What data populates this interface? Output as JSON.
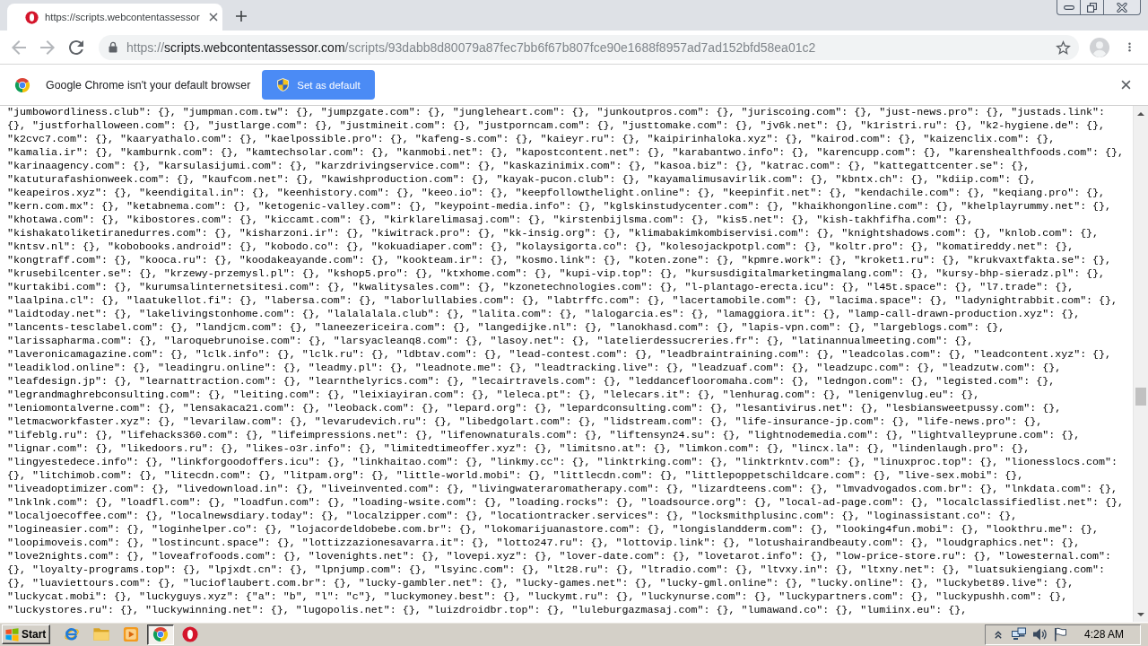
{
  "tabs": [
    {
      "title": "https://scripts.webcontentassessor",
      "selected": true
    }
  ],
  "navigation": [
    {
      "kind": "back",
      "disabled": true
    },
    {
      "kind": "forward",
      "disabled": true
    },
    {
      "kind": "reload",
      "disabled": false
    }
  ],
  "address_bar": {
    "scheme": "https://",
    "host": "scripts.webcontentassessor.com",
    "path": "/scripts/93dabb8d80079a87fec7bb6f67b807fce90e1688f8957ad7ad152bfd58ea01c2",
    "bookmarked": false
  },
  "infobar": {
    "message": "Google Chrome isn't your default browser",
    "button": "Set as default"
  },
  "page": {
    "lines": [
      "\"jumbowordliness.club\": {}, \"jumpman.com.tw\": {}, \"jumpzgate.com\": {}, \"jungleheart.com\": {}, \"junkoutpros.com\": {}, \"juriscoing.com\": {}, \"just-news.pro\": {}, \"justads.link\":",
      "{}, \"justforhalloween.com\": {}, \"justlarge.com\": {}, \"justmineit.com\": {}, \"justporncam.com\": {}, \"justtomake.com\": {}, \"jv6k.net\": {}, \"k1ristri.ru\": {}, \"k2-hygiene.de\": {},",
      "\"k2cvc7.com\": {}, \"kaaryathalo.com\": {}, \"kaelpossible.pro\": {}, \"kafeng-s.com\": {}, \"kaieyr.ru\": {}, \"kaipirinhaloka.xyz\": {}, \"kairod.com\": {}, \"kaizenclix.com\": {},",
      "\"kamalia.ir\": {}, \"kamburnk.com\": {}, \"kamtechsolar.com\": {}, \"kanmobi.net\": {}, \"kapostcontent.net\": {}, \"karabantwo.info\": {}, \"karencupp.com\": {}, \"karenshealthfoods.com\": {},",
      "\"karinaagency.com\": {}, \"karsulasijumi.com\": {}, \"karzdrivingservice.com\": {}, \"kaskazinimix.com\": {}, \"kasoa.biz\": {}, \"katrac.com\": {}, \"kattegattcenter.se\": {},",
      "\"katuturafashionweek.com\": {}, \"kaufcom.net\": {}, \"kawishproduction.com\": {}, \"kayak-pucon.club\": {}, \"kayamalimusavirlik.com\": {}, \"kbntx.ch\": {}, \"kdiip.com\": {},",
      "\"keapeiros.xyz\": {}, \"keendigital.in\": {}, \"keenhistory.com\": {}, \"keeo.io\": {}, \"keepfollowthelight.online\": {}, \"keepinfit.net\": {}, \"kendachile.com\": {}, \"keqiang.pro\": {},",
      "\"kern.com.mx\": {}, \"ketabnema.com\": {}, \"ketogenic-valley.com\": {}, \"keypoint-media.info\": {}, \"kglskinstudycenter.com\": {}, \"khaikhongonline.com\": {}, \"khelplayrummy.net\": {},",
      "\"khotawa.com\": {}, \"kibostores.com\": {}, \"kiccamt.com\": {}, \"kirklarelimasaj.com\": {}, \"kirstenbijlsma.com\": {}, \"kis5.net\": {}, \"kish-takhfifha.com\": {},",
      "\"kishakatoliketiranedurres.com\": {}, \"kisharzoni.ir\": {}, \"kiwitrack.pro\": {}, \"kk-insig.org\": {}, \"klimabakimkombiservisi.com\": {}, \"knightshadows.com\": {}, \"knlob.com\": {},",
      "\"kntsv.nl\": {}, \"kobobooks.android\": {}, \"kobodo.co\": {}, \"kokuadiaper.com\": {}, \"kolaysigorta.co\": {}, \"kolesojackpotpl.com\": {}, \"koltr.pro\": {}, \"komatireddy.net\": {},",
      "\"kongtraff.com\": {}, \"kooca.ru\": {}, \"koodakeayande.com\": {}, \"kookteam.ir\": {}, \"kosmo.link\": {}, \"koten.zone\": {}, \"kpmre.work\": {}, \"kroket1.ru\": {}, \"krukvaxtfakta.se\": {},",
      "\"krusebilcenter.se\": {}, \"krzewy-przemysl.pl\": {}, \"kshop5.pro\": {}, \"ktxhome.com\": {}, \"kupi-vip.top\": {}, \"kursusdigitalmarketingmalang.com\": {}, \"kursy-bhp-sieradz.pl\": {},",
      "\"kurtakibi.com\": {}, \"kurumsalinternetsitesi.com\": {}, \"kwalitysales.com\": {}, \"kzonetechnologies.com\": {}, \"l-plantago-erecta.icu\": {}, \"l45t.space\": {}, \"l7.trade\": {},",
      "\"laalpina.cl\": {}, \"laatukellot.fi\": {}, \"labersa.com\": {}, \"laborlullabies.com\": {}, \"labtrffc.com\": {}, \"lacertamobile.com\": {}, \"lacima.space\": {}, \"ladynightrabbit.com\": {},",
      "\"laidtoday.net\": {}, \"lakelivingstonhome.com\": {}, \"lalalalala.club\": {}, \"lalita.com\": {}, \"lalogarcia.es\": {}, \"lamaggiora.it\": {}, \"lamp-call-drawn-production.xyz\": {},",
      "\"lancents-tesclabel.com\": {}, \"landjcm.com\": {}, \"laneezericeira.com\": {}, \"langedijke.nl\": {}, \"lanokhasd.com\": {}, \"lapis-vpn.com\": {}, \"largeblogs.com\": {},",
      "\"larissapharma.com\": {}, \"laroquebrunoise.com\": {}, \"larsyacleanq8.com\": {}, \"lasoy.net\": {}, \"latelierdessucreries.fr\": {}, \"latinannualmeeting.com\": {},",
      "\"laveronicamagazine.com\": {}, \"lclk.info\": {}, \"lclk.ru\": {}, \"ldbtav.com\": {}, \"lead-contest.com\": {}, \"leadbraintraining.com\": {}, \"leadcolas.com\": {}, \"leadcontent.xyz\": {},",
      "\"leadiklod.online\": {}, \"leadingru.online\": {}, \"leadmy.pl\": {}, \"leadnote.me\": {}, \"leadtracking.live\": {}, \"leadzuaf.com\": {}, \"leadzupc.com\": {}, \"leadzutw.com\": {},",
      "\"leafdesign.jp\": {}, \"learnattraction.com\": {}, \"learnthelyrics.com\": {}, \"lecairtravels.com\": {}, \"leddanceflooromaha.com\": {}, \"ledngon.com\": {}, \"legisted.com\": {},",
      "\"legrandmaghrebconsulting.com\": {}, \"leiting.com\": {}, \"leixiayiran.com\": {}, \"leleca.pt\": {}, \"lelecars.it\": {}, \"lenhurag.com\": {}, \"lenigenvlug.eu\": {},",
      "\"leniomontalverne.com\": {}, \"lensakaca21.com\": {}, \"leoback.com\": {}, \"lepard.org\": {}, \"lepardconsulting.com\": {}, \"lesantivirus.net\": {}, \"lesbiansweetpussy.com\": {},",
      "\"letmacworkfaster.xyz\": {}, \"levarilaw.com\": {}, \"levarudevich.ru\": {}, \"libedgolart.com\": {}, \"lidstream.com\": {}, \"life-insurance-jp.com\": {}, \"life-news.pro\": {},",
      "\"lifeblg.ru\": {}, \"lifehacks360.com\": {}, \"lifeimpressions.net\": {}, \"lifenownaturals.com\": {}, \"liftensyn24.su\": {}, \"lightnodemedia.com\": {}, \"lightvalleyprune.com\": {},",
      "\"lignar.com\": {}, \"likedoors.ru\": {}, \"likes-o3r.info\": {}, \"limitedtimeoffer.xyz\": {}, \"limitsno.at\": {}, \"limkon.com\": {}, \"lincx.la\": {}, \"lindenlaugh.pro\": {},",
      "\"lingyestedece.info\": {}, \"linkforgoodoffers.icu\": {}, \"linkhaitao.com\": {}, \"linkmy.cc\": {}, \"linktrking.com\": {}, \"linktrkntv.com\": {}, \"linuxproc.top\": {}, \"lionesslocs.com\":",
      "{}, \"litchimob.com\": {}, \"litecdn.com\": {}, \"litpam.org\": {}, \"little-world.mobi\": {}, \"littlecdn.com\": {}, \"littlepoppetschildcare.com\": {}, \"live-sex.mobi\": {},",
      "\"liveadoptimizer.com\": {}, \"livedownload.in\": {}, \"liveinvented.com\": {}, \"livingwateraromatherapy.com\": {}, \"lizardteens.com\": {}, \"lmvadvogados.com.br\": {}, \"lnkdata.com\": {},",
      "\"lnklnk.com\": {}, \"loadfl.com\": {}, \"loadfun.com\": {}, \"loading-wsite.com\": {}, \"loading.rocks\": {}, \"loadsource.org\": {}, \"local-ad-page.com\": {}, \"localclassifiedlist.net\": {},",
      "\"localjoecoffee.com\": {}, \"localnewsdiary.today\": {}, \"localzipper.com\": {}, \"locationtracker.services\": {}, \"locksmithplusinc.com\": {}, \"loginassistant.co\": {},",
      "\"logineasier.com\": {}, \"loginhelper.co\": {}, \"lojacordeldobebe.com.br\": {}, \"lokomarijuanastore.com\": {}, \"longislandderm.com\": {}, \"looking4fun.mobi\": {}, \"lookthru.me\": {},",
      "\"loopimoveis.com\": {}, \"lostincunt.space\": {}, \"lottizzazionesavarra.it\": {}, \"lotto247.ru\": {}, \"lottovip.link\": {}, \"lotushairandbeauty.com\": {}, \"loudgraphics.net\": {},",
      "\"love2nights.com\": {}, \"loveafrofoods.com\": {}, \"lovenights.net\": {}, \"lovepi.xyz\": {}, \"lover-date.com\": {}, \"lovetarot.info\": {}, \"low-price-store.ru\": {}, \"lowesternal.com\":",
      "{}, \"loyalty-programs.top\": {}, \"lpjxdt.cn\": {}, \"lpnjump.com\": {}, \"lsyinc.com\": {}, \"lt28.ru\": {}, \"ltradio.com\": {}, \"ltvxy.in\": {}, \"ltxny.net\": {}, \"luatsukiengiang.com\":",
      "{}, \"luaviettours.com\": {}, \"lucioflaubert.com.br\": {}, \"lucky-gambler.net\": {}, \"lucky-games.net\": {}, \"lucky-gml.online\": {}, \"lucky.online\": {}, \"luckybet89.live\": {},",
      "\"luckycat.mobi\": {}, \"luckyguys.xyz\": {\"a\": \"b\", \"l\": \"c\"}, \"luckymoney.best\": {}, \"luckymt.ru\": {}, \"luckynurse.com\": {}, \"luckypartners.com\": {}, \"luckypushh.com\": {},",
      "\"luckystores.ru\": {}, \"luckywinning.net\": {}, \"lugopolis.net\": {}, \"luizdroidbr.top\": {}, \"luleburgazmasaj.com\": {}, \"lumawand.co\": {}, \"lumiinx.eu\": {},"
    ]
  },
  "taskbar": {
    "start": "Start",
    "apps": [
      {
        "kind": "ie",
        "selected": false
      },
      {
        "kind": "folder",
        "selected": false
      },
      {
        "kind": "media",
        "selected": false
      },
      {
        "kind": "chrome",
        "selected": true
      },
      {
        "kind": "ring",
        "selected": false
      }
    ],
    "clock": "4:28 AM"
  }
}
